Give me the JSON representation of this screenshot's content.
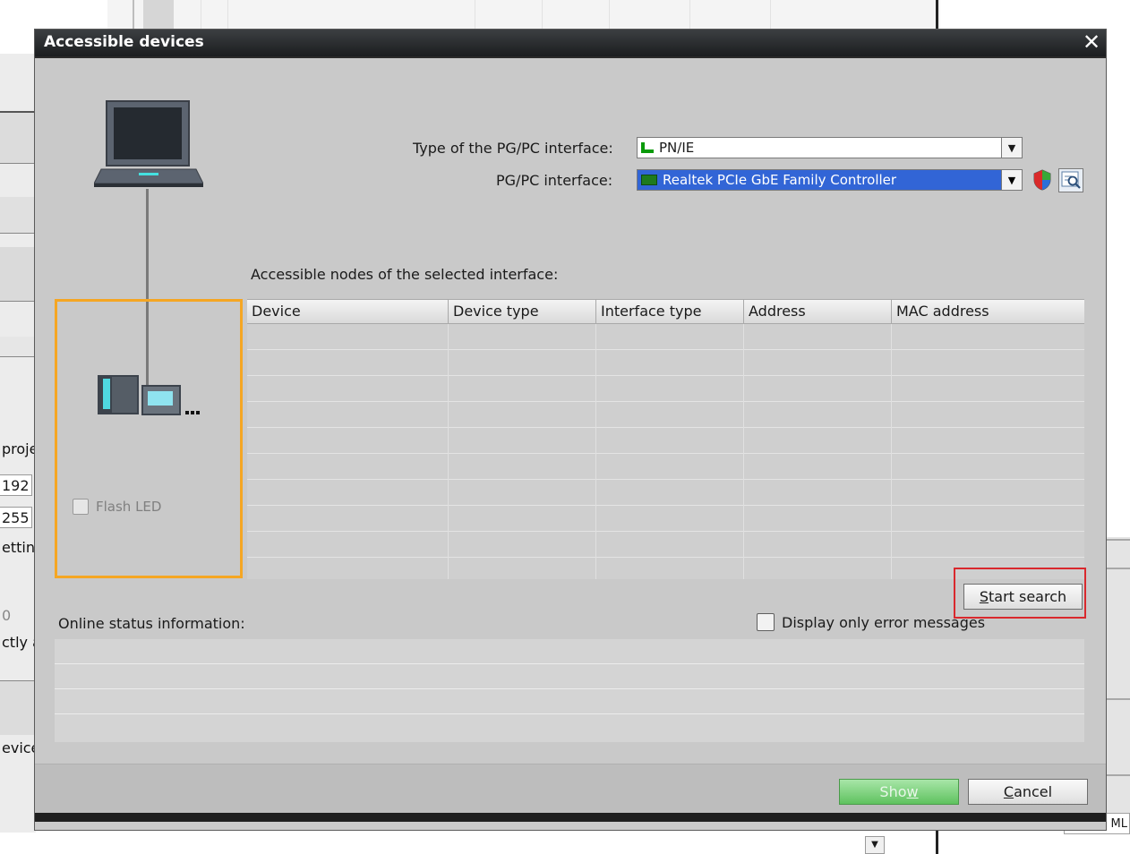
{
  "background": {
    "left_fragments": [
      "proje",
      "192",
      "255",
      "etting",
      "0",
      "ctly a",
      "evice"
    ],
    "right_fragment": "ML"
  },
  "dialog": {
    "title": "Accessible devices",
    "close_glyph": "✕",
    "type_label": "Type of the PG/PC interface:",
    "type_value": "PN/IE",
    "interface_label": "PG/PC interface:",
    "interface_value": "Realtek PCIe GbE Family Controller",
    "nodes_label": "Accessible nodes of the selected interface:",
    "columns": [
      "Device",
      "Device type",
      "Interface type",
      "Address",
      "MAC address"
    ],
    "rows": [],
    "flash_led_label": "Flash LED",
    "start_search_prefix": "S",
    "start_search_rest": "tart search",
    "online_status_label": "Online status information:",
    "error_only_label": "Display only error messages",
    "show_main": "Sho",
    "show_key": "w",
    "cancel_key": "C",
    "cancel_rest": "ancel"
  },
  "colors": {
    "highlight_panel": "#f5a623",
    "highlight_button": "#d9282d",
    "selected_combo": "#3265d6",
    "show_button": "#5fc25f"
  }
}
